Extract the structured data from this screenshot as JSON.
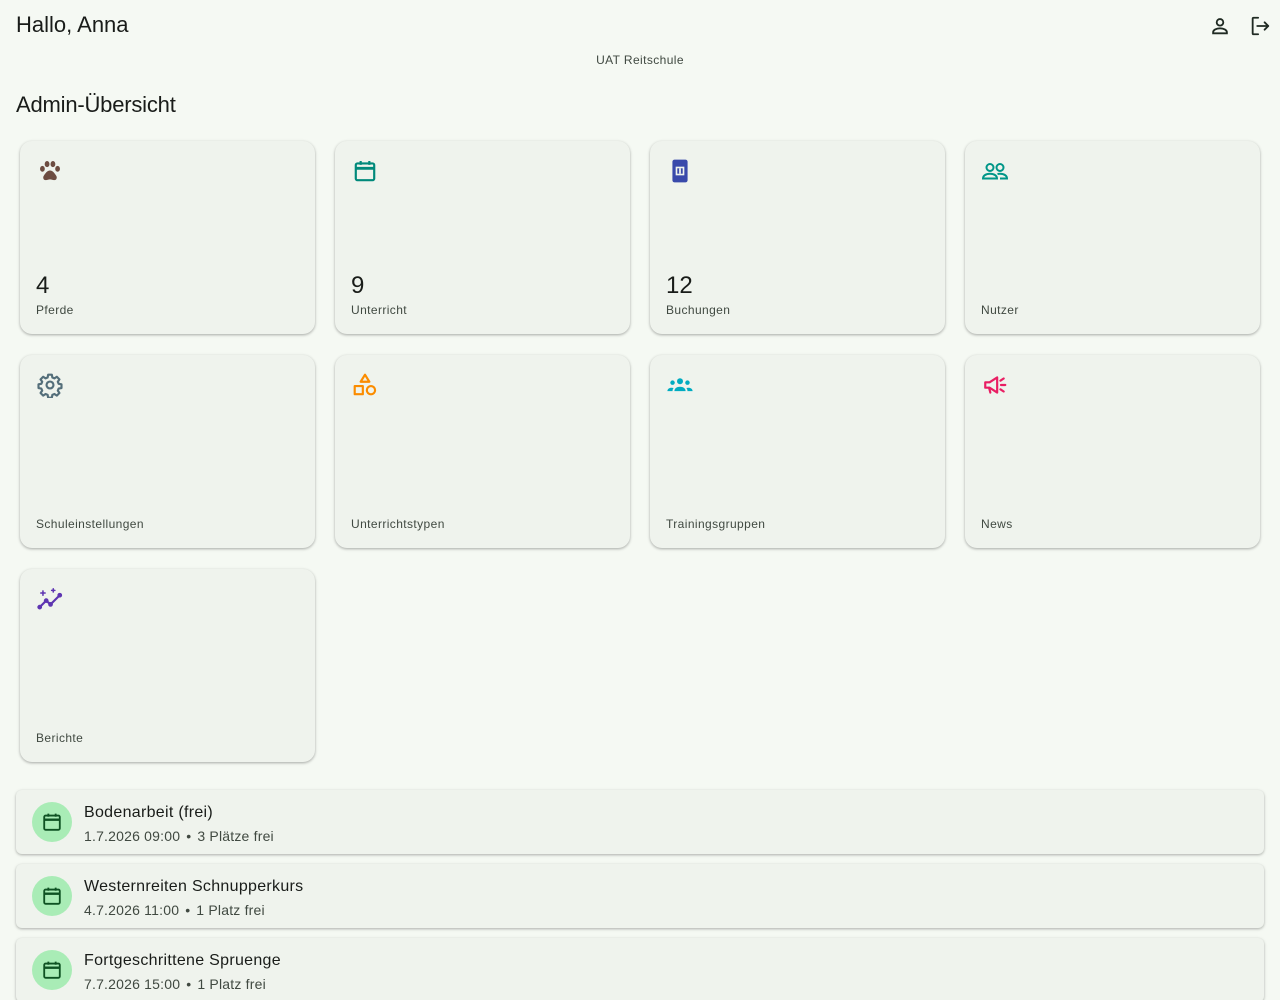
{
  "header": {
    "greeting": "Hallo, Anna",
    "school_name": "UAT Reitschule",
    "icons": [
      "person-icon",
      "logout-icon"
    ]
  },
  "dashboard": {
    "title": "Admin-Übersicht",
    "tiles": [
      {
        "value": "4",
        "label": "Pferde",
        "icon": "paw-icon",
        "color": "#6d4c41"
      },
      {
        "value": "9",
        "label": "Unterricht",
        "icon": "calendar-icon",
        "color": "#00897b"
      },
      {
        "value": "12",
        "label": "Buchungen",
        "icon": "ticket-icon",
        "color": "#3949ab"
      },
      {
        "value": "",
        "label": "Nutzer",
        "icon": "users-icon",
        "color": "#009688"
      },
      {
        "value": "",
        "label": "Schuleinstellungen",
        "icon": "gear-icon",
        "color": "#546e7a"
      },
      {
        "value": "",
        "label": "Unterrichtstypen",
        "icon": "shapes-icon",
        "color": "#fb8c00"
      },
      {
        "value": "",
        "label": "Trainingsgruppen",
        "icon": "groups-icon",
        "color": "#00acc1"
      },
      {
        "value": "",
        "label": "News",
        "icon": "megaphone-icon",
        "color": "#e91e63"
      },
      {
        "value": "",
        "label": "Berichte",
        "icon": "insights-icon",
        "color": "#5e35b1"
      }
    ]
  },
  "upcoming": [
    {
      "title": "Bodenarbeit (frei)",
      "datetime": "1.7.2026 09:00",
      "separator": "•",
      "availability": "3 Plätze frei"
    },
    {
      "title": "Westernreiten Schnupperkurs",
      "datetime": "4.7.2026 11:00",
      "separator": "•",
      "availability": "1 Platz frei"
    },
    {
      "title": "Fortgeschrittene Spruenge",
      "datetime": "7.7.2026 15:00",
      "separator": "•",
      "availability": "1 Platz frei"
    }
  ],
  "colors": {
    "background": "#f5f9f3",
    "card": "#eff3ed",
    "avatar": "#a9ecb6",
    "avatar_icon": "#0f5223"
  }
}
